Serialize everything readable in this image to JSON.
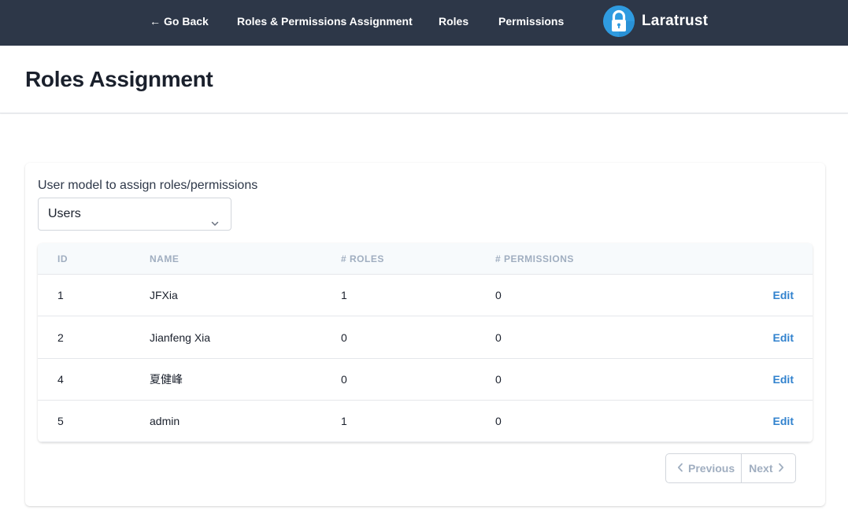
{
  "nav": {
    "back_arrow": "←",
    "back_label": "Go Back",
    "roles_permissions_assignment": "Roles & Permissions Assignment",
    "roles": "Roles",
    "permissions": "Permissions",
    "brand_name": "Laratrust",
    "brand_logo_icon": "lock-icon",
    "background_color": "#2d3748"
  },
  "header": {
    "title": "Roles Assignment"
  },
  "model_selector": {
    "label": "User model to assign roles/permissions",
    "selected": "Users"
  },
  "table": {
    "columns": [
      "ID",
      "Name",
      "# Roles",
      "# Permissions"
    ],
    "rows": [
      {
        "id": "1",
        "name": "JFXia",
        "roles": "1",
        "permissions": "0",
        "action": "Edit"
      },
      {
        "id": "2",
        "name": "Jianfeng Xia",
        "roles": "0",
        "permissions": "0",
        "action": "Edit"
      },
      {
        "id": "4",
        "name": "夏健峰",
        "roles": "0",
        "permissions": "0",
        "action": "Edit"
      },
      {
        "id": "5",
        "name": "admin",
        "roles": "1",
        "permissions": "0",
        "action": "Edit"
      }
    ]
  },
  "pagination": {
    "previous_label": "Previous",
    "next_label": "Next"
  },
  "colors": {
    "accent": "#3182ce",
    "brand_logo": "#2f9be0"
  }
}
